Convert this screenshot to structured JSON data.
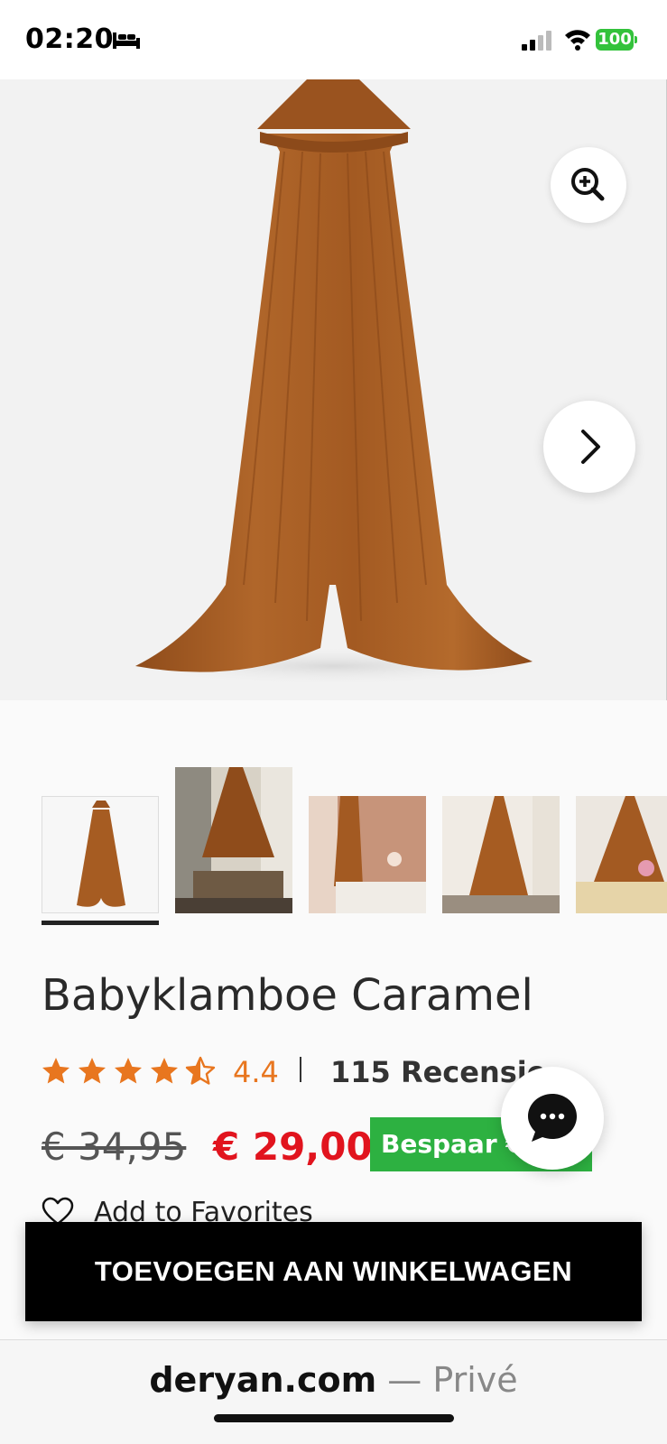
{
  "status_bar": {
    "time": "02:20",
    "battery": "100",
    "icons": [
      "bed-icon",
      "cellular-signal-icon",
      "wifi-icon",
      "battery-icon"
    ]
  },
  "hero": {
    "icons": [
      "zoom-in-icon",
      "chevron-right-icon"
    ]
  },
  "thumbnails": {
    "count": 5,
    "selected_index": 0
  },
  "product": {
    "title": "Babyklamboe Caramel",
    "rating": 4.4,
    "rating_label": "4.4",
    "stars_max": 5,
    "reviews": "115 Recensie",
    "price_old": "€ 34,95",
    "price_new": "€ 29,00",
    "save_label": "Bespaar €5,95",
    "favorites_label": "Add to Favorites"
  },
  "colors": {
    "star": "#e8761f",
    "price_new": "#e1141e",
    "save_badge": "#2db141",
    "canopy": "#a65c22"
  },
  "actions": {
    "add_to_cart": "TOEVOEGEN AAN WINKELWAGEN"
  },
  "browser": {
    "domain": "deryan.com",
    "mode": " — Privé"
  }
}
